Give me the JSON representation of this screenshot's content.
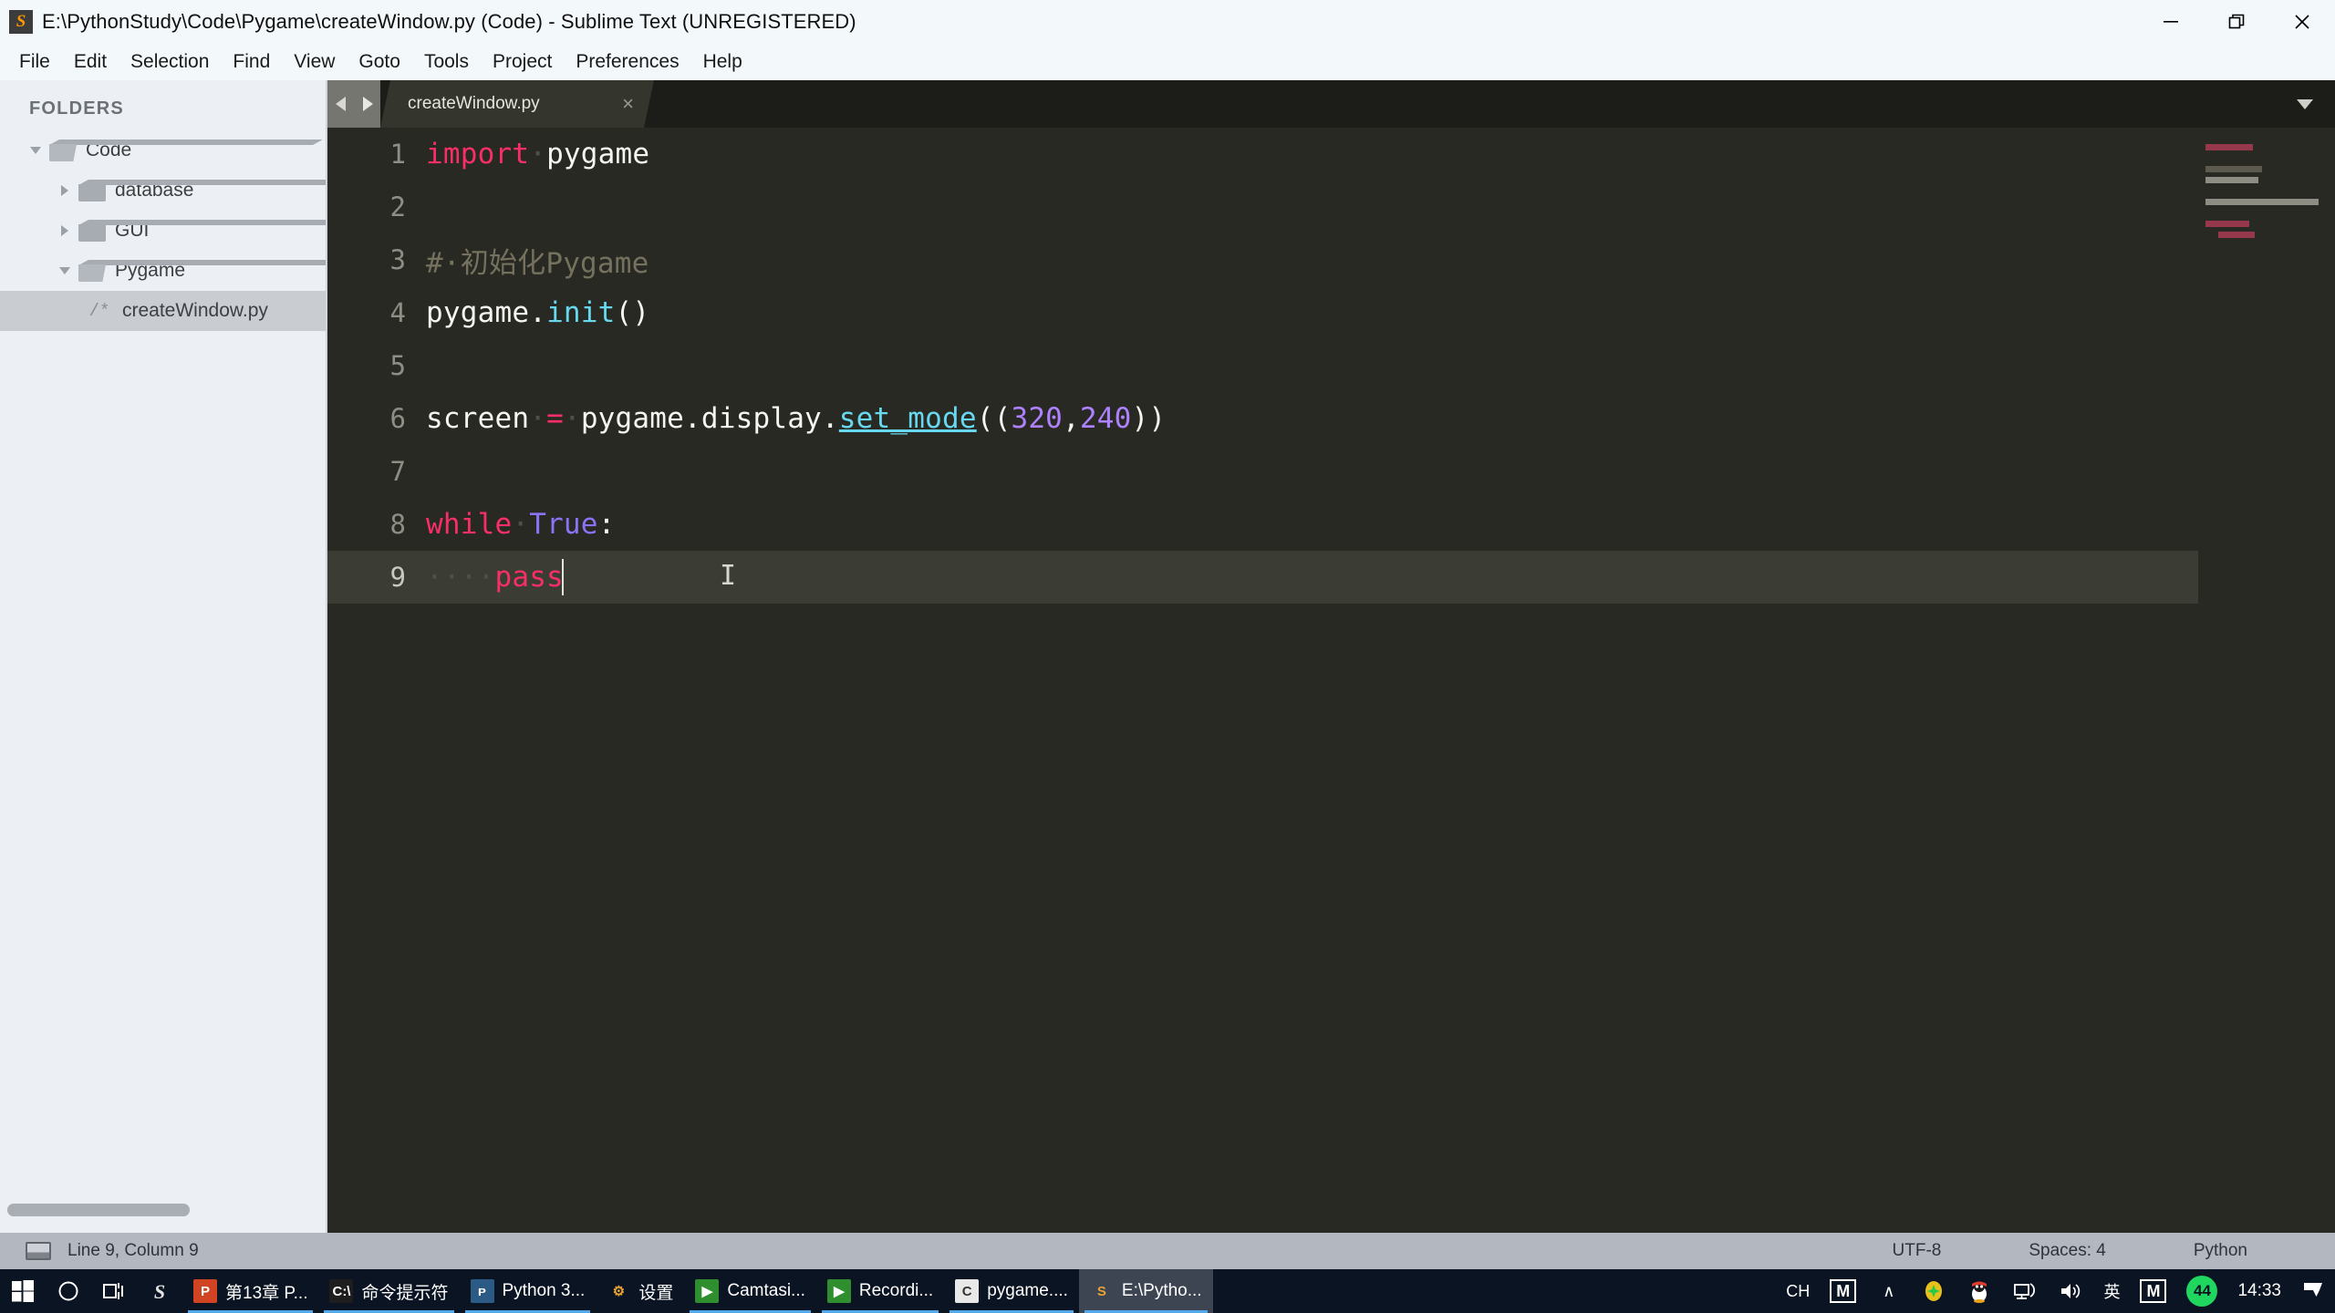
{
  "window": {
    "title": "E:\\PythonStudy\\Code\\Pygame\\createWindow.py (Code) - Sublime Text (UNREGISTERED)",
    "app_icon": "sublime-text-icon",
    "minimize_label": "—",
    "maximize_label": "❐",
    "close_label": "✕"
  },
  "menubar": {
    "items": [
      {
        "label": "File"
      },
      {
        "label": "Edit"
      },
      {
        "label": "Selection"
      },
      {
        "label": "Find"
      },
      {
        "label": "View"
      },
      {
        "label": "Goto"
      },
      {
        "label": "Tools"
      },
      {
        "label": "Project"
      },
      {
        "label": "Preferences"
      },
      {
        "label": "Help"
      }
    ]
  },
  "sidebar": {
    "header": "FOLDERS",
    "tree": [
      {
        "label": "Code",
        "type": "folder",
        "state": "expanded",
        "depth": 0,
        "selected": false
      },
      {
        "label": "database",
        "type": "folder",
        "state": "collapsed",
        "depth": 1,
        "selected": false
      },
      {
        "label": "GUI",
        "type": "folder",
        "state": "collapsed",
        "depth": 1,
        "selected": false
      },
      {
        "label": "Pygame",
        "type": "folder",
        "state": "expanded",
        "depth": 1,
        "selected": false
      },
      {
        "label": "createWindow.py",
        "type": "file",
        "icon": "/*",
        "depth": 2,
        "selected": true
      }
    ]
  },
  "editor": {
    "tab": {
      "label": "createWindow.py",
      "close_label": "×"
    },
    "nav_prev": "◀",
    "nav_next": "▶",
    "tab_dropdown": "▼",
    "lines": [
      {
        "num": "1",
        "tokens": [
          {
            "t": "import",
            "c": "kw"
          },
          {
            "t": "·",
            "c": "dot"
          },
          {
            "t": "pygame",
            "c": "punc"
          }
        ]
      },
      {
        "num": "2",
        "tokens": []
      },
      {
        "num": "3",
        "tokens": [
          {
            "t": "#·初始化Pygame",
            "c": "com"
          }
        ]
      },
      {
        "num": "4",
        "tokens": [
          {
            "t": "pygame",
            "c": "punc"
          },
          {
            "t": ".",
            "c": "punc"
          },
          {
            "t": "init",
            "c": "fn"
          },
          {
            "t": "()",
            "c": "punc"
          }
        ]
      },
      {
        "num": "5",
        "tokens": []
      },
      {
        "num": "6",
        "tokens": [
          {
            "t": "screen",
            "c": "punc"
          },
          {
            "t": "·",
            "c": "dot"
          },
          {
            "t": "=",
            "c": "op"
          },
          {
            "t": "·",
            "c": "dot"
          },
          {
            "t": "pygame",
            "c": "punc"
          },
          {
            "t": ".",
            "c": "punc"
          },
          {
            "t": "display",
            "c": "punc"
          },
          {
            "t": ".",
            "c": "punc"
          },
          {
            "t": "set_mode",
            "c": "fn-u"
          },
          {
            "t": "((",
            "c": "punc"
          },
          {
            "t": "320",
            "c": "num"
          },
          {
            "t": ",",
            "c": "punc"
          },
          {
            "t": "240",
            "c": "num"
          },
          {
            "t": "))",
            "c": "punc"
          }
        ]
      },
      {
        "num": "7",
        "tokens": []
      },
      {
        "num": "8",
        "tokens": [
          {
            "t": "while",
            "c": "kw"
          },
          {
            "t": "·",
            "c": "dot"
          },
          {
            "t": "True",
            "c": "cls"
          },
          {
            "t": ":",
            "c": "punc"
          }
        ]
      },
      {
        "num": "9",
        "active": true,
        "tokens": [
          {
            "t": "····",
            "c": "dot"
          },
          {
            "t": "pass",
            "c": "kw"
          }
        ]
      }
    ],
    "mouse_cursor_glyph": "I"
  },
  "statusbar": {
    "position": "Line 9, Column 9",
    "encoding": "UTF-8",
    "indentation": "Spaces: 4",
    "syntax": "Python"
  },
  "taskbar": {
    "system_buttons": [
      {
        "name": "start-button",
        "glyph": "start"
      },
      {
        "name": "cortana-button",
        "glyph": "circle"
      },
      {
        "name": "task-view-button",
        "glyph": "taskview"
      },
      {
        "name": "sublime-pin",
        "glyph": "sublime"
      }
    ],
    "apps": [
      {
        "label": "第13章 P...",
        "icon": "P",
        "icon_bg": "#d04423",
        "active": false,
        "running": true
      },
      {
        "label": "命令提示符",
        "icon": "C:\\",
        "icon_bg": "#1e1e1e",
        "active": false,
        "running": true
      },
      {
        "label": "Python 3...",
        "icon": "ᴩ",
        "icon_bg": "#2b5b84",
        "active": false,
        "running": true
      },
      {
        "label": "设置",
        "icon": "⚙",
        "icon_bg": "transparent",
        "active": false,
        "running": false
      },
      {
        "label": "Camtasi...",
        "icon": "▶",
        "icon_bg": "#2f8f2f",
        "active": false,
        "running": true
      },
      {
        "label": "Recordi...",
        "icon": "▶",
        "icon_bg": "#2f8f2f",
        "active": false,
        "running": true
      },
      {
        "label": "pygame....",
        "icon": "C",
        "icon_bg": "#e8e8e8",
        "active": false,
        "running": true
      },
      {
        "label": "E:\\Pytho...",
        "icon": "S",
        "icon_bg": "transparent",
        "active": true,
        "running": true
      }
    ],
    "tray": {
      "ime_left": "CH",
      "ime_m": "M",
      "expand": "∧",
      "items": [
        {
          "name": "security-shield-icon"
        },
        {
          "name": "qq-penguin-icon"
        },
        {
          "name": "network-icon"
        },
        {
          "name": "volume-icon"
        },
        {
          "name": "ime-lang-icon",
          "label": "英"
        },
        {
          "name": "ime-mode-icon",
          "label": "M"
        }
      ],
      "badge": "44",
      "clock": "14:33",
      "action_center": "notification-icon"
    }
  }
}
